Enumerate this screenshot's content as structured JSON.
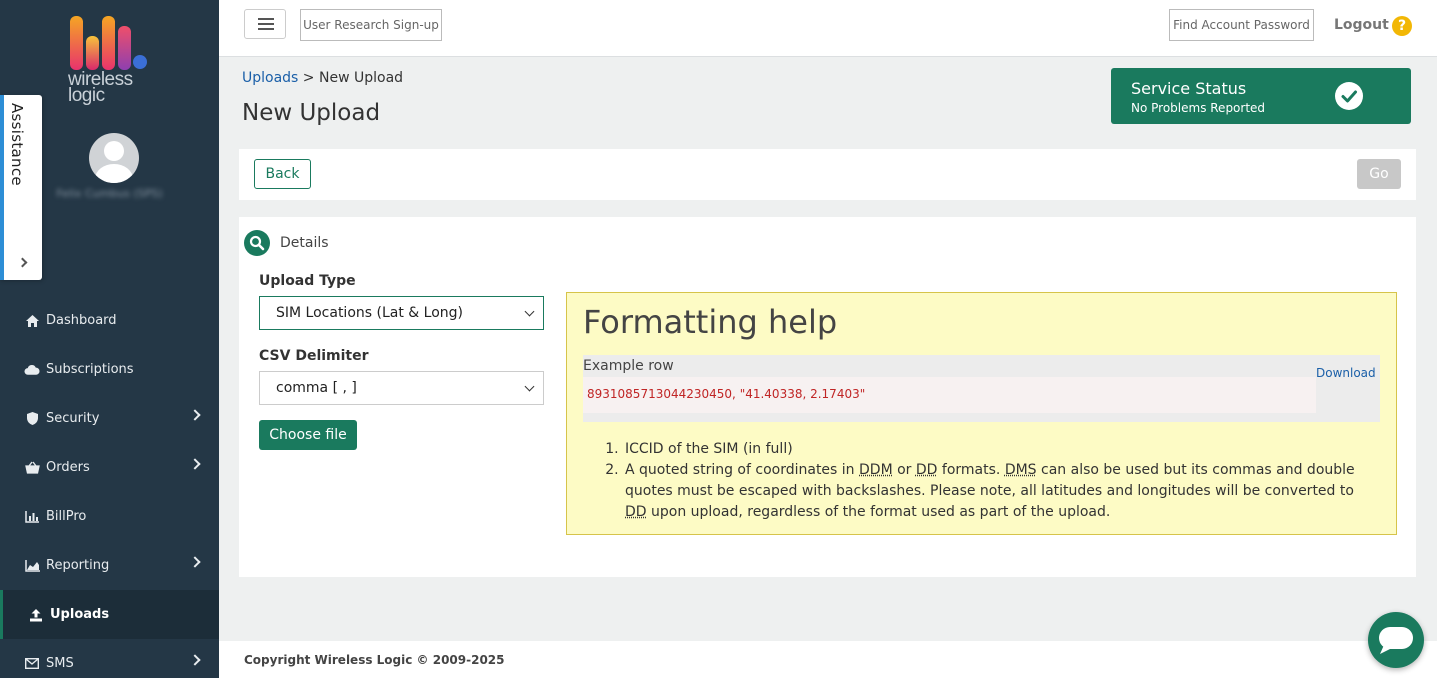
{
  "brand": {
    "logo_text": "wireless logic",
    "accent": "#1a7a5e",
    "sidebar_bg": "#243746"
  },
  "user": {
    "name": "Felix Cumbus (SPS)"
  },
  "assistance": {
    "label": "Assistance"
  },
  "sidebar": {
    "items": [
      {
        "label": "Dashboard",
        "icon": "home-icon",
        "has_submenu": false,
        "active": false
      },
      {
        "label": "Subscriptions",
        "icon": "cloud-icon",
        "has_submenu": false,
        "active": false
      },
      {
        "label": "Security",
        "icon": "shield-icon",
        "has_submenu": true,
        "active": false
      },
      {
        "label": "Orders",
        "icon": "basket-icon",
        "has_submenu": true,
        "active": false
      },
      {
        "label": "BillPro",
        "icon": "bar-chart-icon",
        "has_submenu": false,
        "active": false
      },
      {
        "label": "Reporting",
        "icon": "area-chart-icon",
        "has_submenu": true,
        "active": false
      },
      {
        "label": "Uploads",
        "icon": "upload-icon",
        "has_submenu": false,
        "active": true
      },
      {
        "label": "SMS",
        "icon": "envelope-icon",
        "has_submenu": true,
        "active": false
      }
    ]
  },
  "topbar": {
    "research_label": "User Research Sign-up",
    "find_password_label": "Find Account Password",
    "logout_label": "Logout",
    "help_label": "?"
  },
  "breadcrumb": {
    "parent": "Uploads",
    "separator": " > ",
    "current": "New Upload"
  },
  "page": {
    "title": "New Upload"
  },
  "service_status": {
    "title": "Service Status",
    "subtitle": "No Problems Reported"
  },
  "actions": {
    "back_label": "Back",
    "go_label": "Go"
  },
  "details": {
    "section_label": "Details",
    "upload_type_label": "Upload Type",
    "upload_type_value": "SIM Locations (Lat & Long)",
    "delimiter_label": "CSV Delimiter",
    "delimiter_value": "comma [ , ]",
    "choose_file_label": "Choose file"
  },
  "formatting_help": {
    "title": "Formatting help",
    "example_label": "Example row",
    "example_value": "8931085713044230450, \"41.40338, 2.17403\"",
    "download_label": "Download",
    "item1": "ICCID of the SIM (in full)",
    "item2": {
      "t1": "A quoted string of coordinates in ",
      "a1": "DDM",
      "t2": " or ",
      "a2": "DD",
      "t3": " formats. ",
      "a3": "DMS",
      "t4": " can also be used but its commas and double quotes must be escaped with backslashes. Please note, all latitudes and longitudes will be converted to ",
      "a4": "DD",
      "t5": " upon upload, regardless of the format used as part of the upload."
    }
  },
  "footer": {
    "copyright": "Copyright Wireless Logic © 2009-2025"
  }
}
